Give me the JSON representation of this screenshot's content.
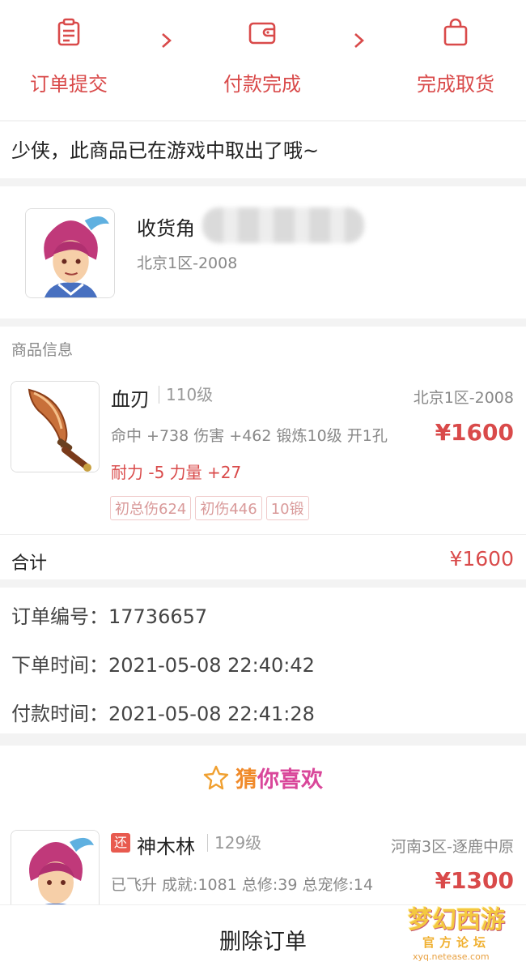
{
  "steps": [
    {
      "label": "订单提交",
      "icon": "clipboard-icon"
    },
    {
      "label": "付款完成",
      "icon": "wallet-icon"
    },
    {
      "label": "完成取货",
      "icon": "bag-icon"
    }
  ],
  "notice": "少侠，此商品已在游戏中取出了哦~",
  "receiver": {
    "label": "收货角",
    "server": "北京1区-2008"
  },
  "goods": {
    "section_title": "商品信息",
    "item": {
      "name": "血刃",
      "level": "110级",
      "server": "北京1区-2008",
      "attributes": "命中 +738 伤害 +462 锻炼10级 开1孔",
      "extra": "耐力 -5 力量 +27",
      "price": "¥1600",
      "tags": [
        "初总伤624",
        "初伤446",
        "10锻"
      ]
    },
    "total_label": "合计",
    "total_value": "¥1600"
  },
  "order": {
    "number_label": "订单编号：",
    "number": "17736657",
    "created_label": "下单时间：",
    "created": "2021-05-08 22:40:42",
    "paid_label": "付款时间：",
    "paid": "2021-05-08 22:41:28"
  },
  "recommend": {
    "title_a": "猜",
    "title_b": "你喜欢",
    "item": {
      "badge": "还",
      "name": "神木林",
      "level": "129级",
      "server": "河南3区-逐鹿中原",
      "desc": "已飞升 成就:1081 总修:39 总宠修:14",
      "price": "¥1300"
    }
  },
  "actions": {
    "delete_order": "删除订单"
  },
  "watermark": {
    "logo": "梦幻西游",
    "sub": "官方论坛",
    "url": "xyq.netease.com"
  },
  "colors": {
    "accent": "#d94a4a",
    "orange": "#f08a2a",
    "pink": "#d9479a"
  }
}
